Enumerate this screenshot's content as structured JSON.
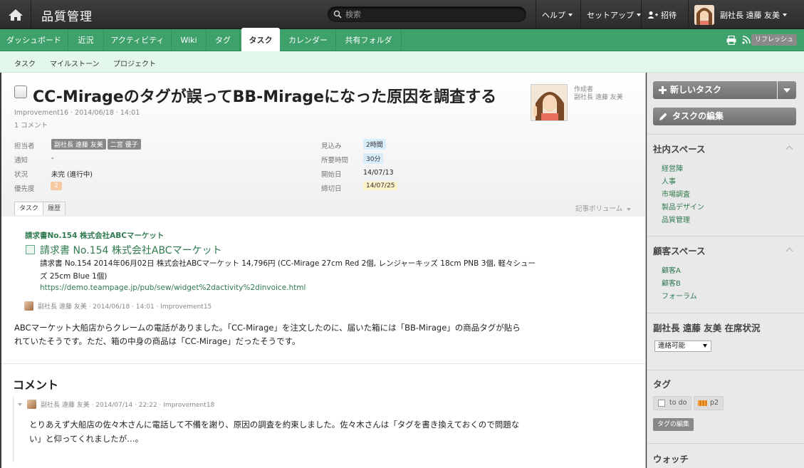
{
  "app": {
    "title": "品質管理"
  },
  "search": {
    "placeholder": "検索"
  },
  "top_menu": {
    "help": "ヘルプ",
    "setup": "セットアップ",
    "invite": "招待",
    "user": "副社長 遠藤 友美"
  },
  "nav": {
    "tabs": [
      {
        "label": "ダッシュボード"
      },
      {
        "label": "近況"
      },
      {
        "label": "アクティビティ"
      },
      {
        "label": "Wiki"
      },
      {
        "label": "タグ"
      },
      {
        "label": "タスク"
      },
      {
        "label": "カレンダー"
      },
      {
        "label": "共有フォルダ"
      }
    ],
    "refresh": "リフレッシュ"
  },
  "subnav": {
    "items": [
      {
        "label": "タスク"
      },
      {
        "label": "マイルストーン"
      },
      {
        "label": "プロジェクト"
      }
    ]
  },
  "task": {
    "title": "CC-Mirageのタグが誤ってBB-Mirageになった原因を調査する",
    "meta": "Improvement16 · 2014/06/18 · 14:01",
    "comment_count": "1 コメント",
    "author_label": "作成者",
    "author_name": "副社長 遠藤 友美",
    "fields": {
      "assignee_label": "担当者",
      "assignee_1": "副社長 遠藤 友美",
      "assignee_2": "二宮 優子",
      "notify_label": "通知",
      "notify": "-",
      "status_label": "状況",
      "status": "未完 (進行中)",
      "priority_label": "優先度",
      "priority": "2",
      "estimate_label": "見込み",
      "estimate": "2時間",
      "spent_label": "所要時間",
      "spent": "30分",
      "start_label": "開始日",
      "start": "14/07/13",
      "due_label": "締切日",
      "due": "14/07/25"
    },
    "tabs": {
      "task": "タスク",
      "history": "履歴"
    },
    "volume": "記事ボリューム"
  },
  "quote": {
    "head": "請求書No.154 株式会社ABCマーケット",
    "link": "請求書 No.154 株式会社ABCマーケット",
    "desc": "請求書 No.154 2014年06月02日 株式会社ABCマーケット 14,796円 (CC-Mirage 27cm Red 2個, レンジャーキッズ 18cm PNB 3個, 軽々シューズ 25cm Blue 1個)",
    "url": "https://demo.teampage.jp/pub/sew/widget%2dactivity%2dinvoice.html",
    "meta": "副社長 遠藤 友美 · 2014/06/18 · 14:01 · Improvement15"
  },
  "body": "ABCマーケット大船店からクレームの電話がありました。「CC-Mirage」を注文したのに、届いた箱には「BB-Mirage」の商品タグが貼られていたそうです。ただ、箱の中身の商品は「CC-Mirage」だったそうです。",
  "comments": {
    "title": "コメント",
    "items": [
      {
        "meta": "副社長 遠藤 友美 · 2014/07/14 · 22:22 · Improvement18",
        "text": "とりあえず大船店の佐々木さんに電話して不備を謝り、原因の調査を約束しました。佐々木さんは「タグを書き換えておくので問題ない」と仰ってくれましたが…。"
      }
    ]
  },
  "sidebar": {
    "new_task": "新しいタスク",
    "edit_task": "タスクの編集",
    "internal": {
      "title": "社内スペース",
      "items": [
        "経営陣",
        "人事",
        "市場調査",
        "製品デザイン",
        "品質管理"
      ]
    },
    "customer": {
      "title": "顧客スペース",
      "items": [
        "顧客A",
        "顧客B",
        "フォーラム"
      ]
    },
    "presence": {
      "title": "副社長 遠藤 友美 在席状況",
      "value": "連絡可能"
    },
    "tags": {
      "title": "タグ",
      "items": [
        "to do",
        "p2"
      ],
      "edit": "タグの編集"
    },
    "watch": {
      "title": "ウォッチ"
    }
  }
}
